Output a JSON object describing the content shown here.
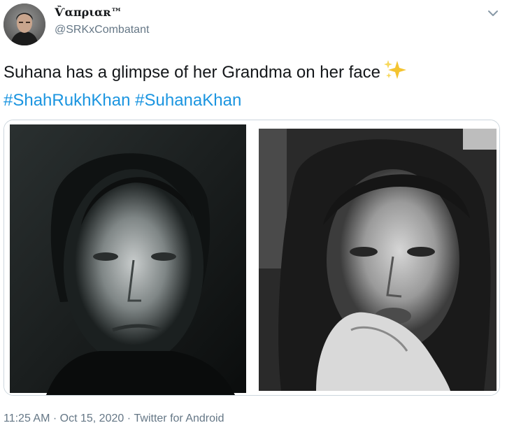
{
  "author": {
    "display_name": "Ѷαπριαʀ™",
    "handle": "@SRKxCombatant",
    "avatar_icon": "profile-avatar"
  },
  "tweet": {
    "text": "Suhana has a glimpse of her Grandma on her face",
    "emoji_icon": "sparkles-icon",
    "hashtags": [
      "#ShahRukhKhan",
      "#SuhanaKhan"
    ]
  },
  "media": {
    "photos": [
      {
        "name": "left-photo",
        "subject": "black-and-white portrait, young man"
      },
      {
        "name": "right-photo",
        "subject": "black-and-white portrait, young woman, hand on chin"
      }
    ]
  },
  "meta": {
    "time": "11:25 AM",
    "separator": "·",
    "date": "Oct 15, 2020",
    "source": "Twitter for Android"
  },
  "colors": {
    "text": "#14171a",
    "secondary": "#657786",
    "link": "#1b95e0",
    "border": "#ccd6dd"
  }
}
